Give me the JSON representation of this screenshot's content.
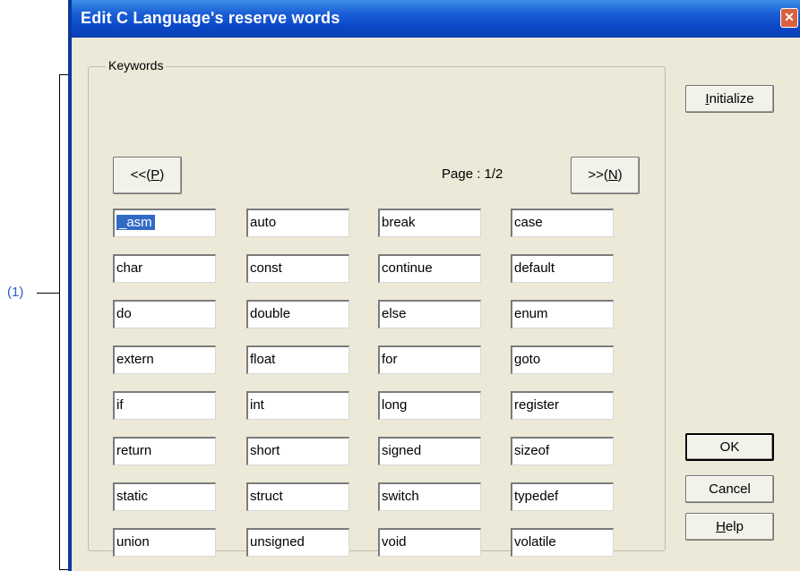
{
  "annotation": {
    "label": "(1)"
  },
  "window": {
    "title": "Edit C Language's reserve words",
    "close_symbol": "✕"
  },
  "group": {
    "legend": "Keywords"
  },
  "buttons": {
    "initialize": {
      "mnemonic": "I",
      "rest": "nitialize"
    },
    "prev": {
      "pre": "<<(",
      "mnemonic": "P",
      "post": ")"
    },
    "next": {
      "pre": ">>(",
      "mnemonic": "N",
      "post": ")"
    },
    "ok": "OK",
    "cancel": "Cancel",
    "help": {
      "mnemonic": "H",
      "rest": "elp"
    }
  },
  "page_indicator": "Page : 1/2",
  "selected_index": 0,
  "keywords": [
    "_asm",
    "auto",
    "break",
    "case",
    "char",
    "const",
    "continue",
    "default",
    "do",
    "double",
    "else",
    "enum",
    "extern",
    "float",
    "for",
    "goto",
    "if",
    "int",
    "long",
    "register",
    "return",
    "short",
    "signed",
    "sizeof",
    "static",
    "struct",
    "switch",
    "typedef",
    "union",
    "unsigned",
    "void",
    "volatile"
  ]
}
